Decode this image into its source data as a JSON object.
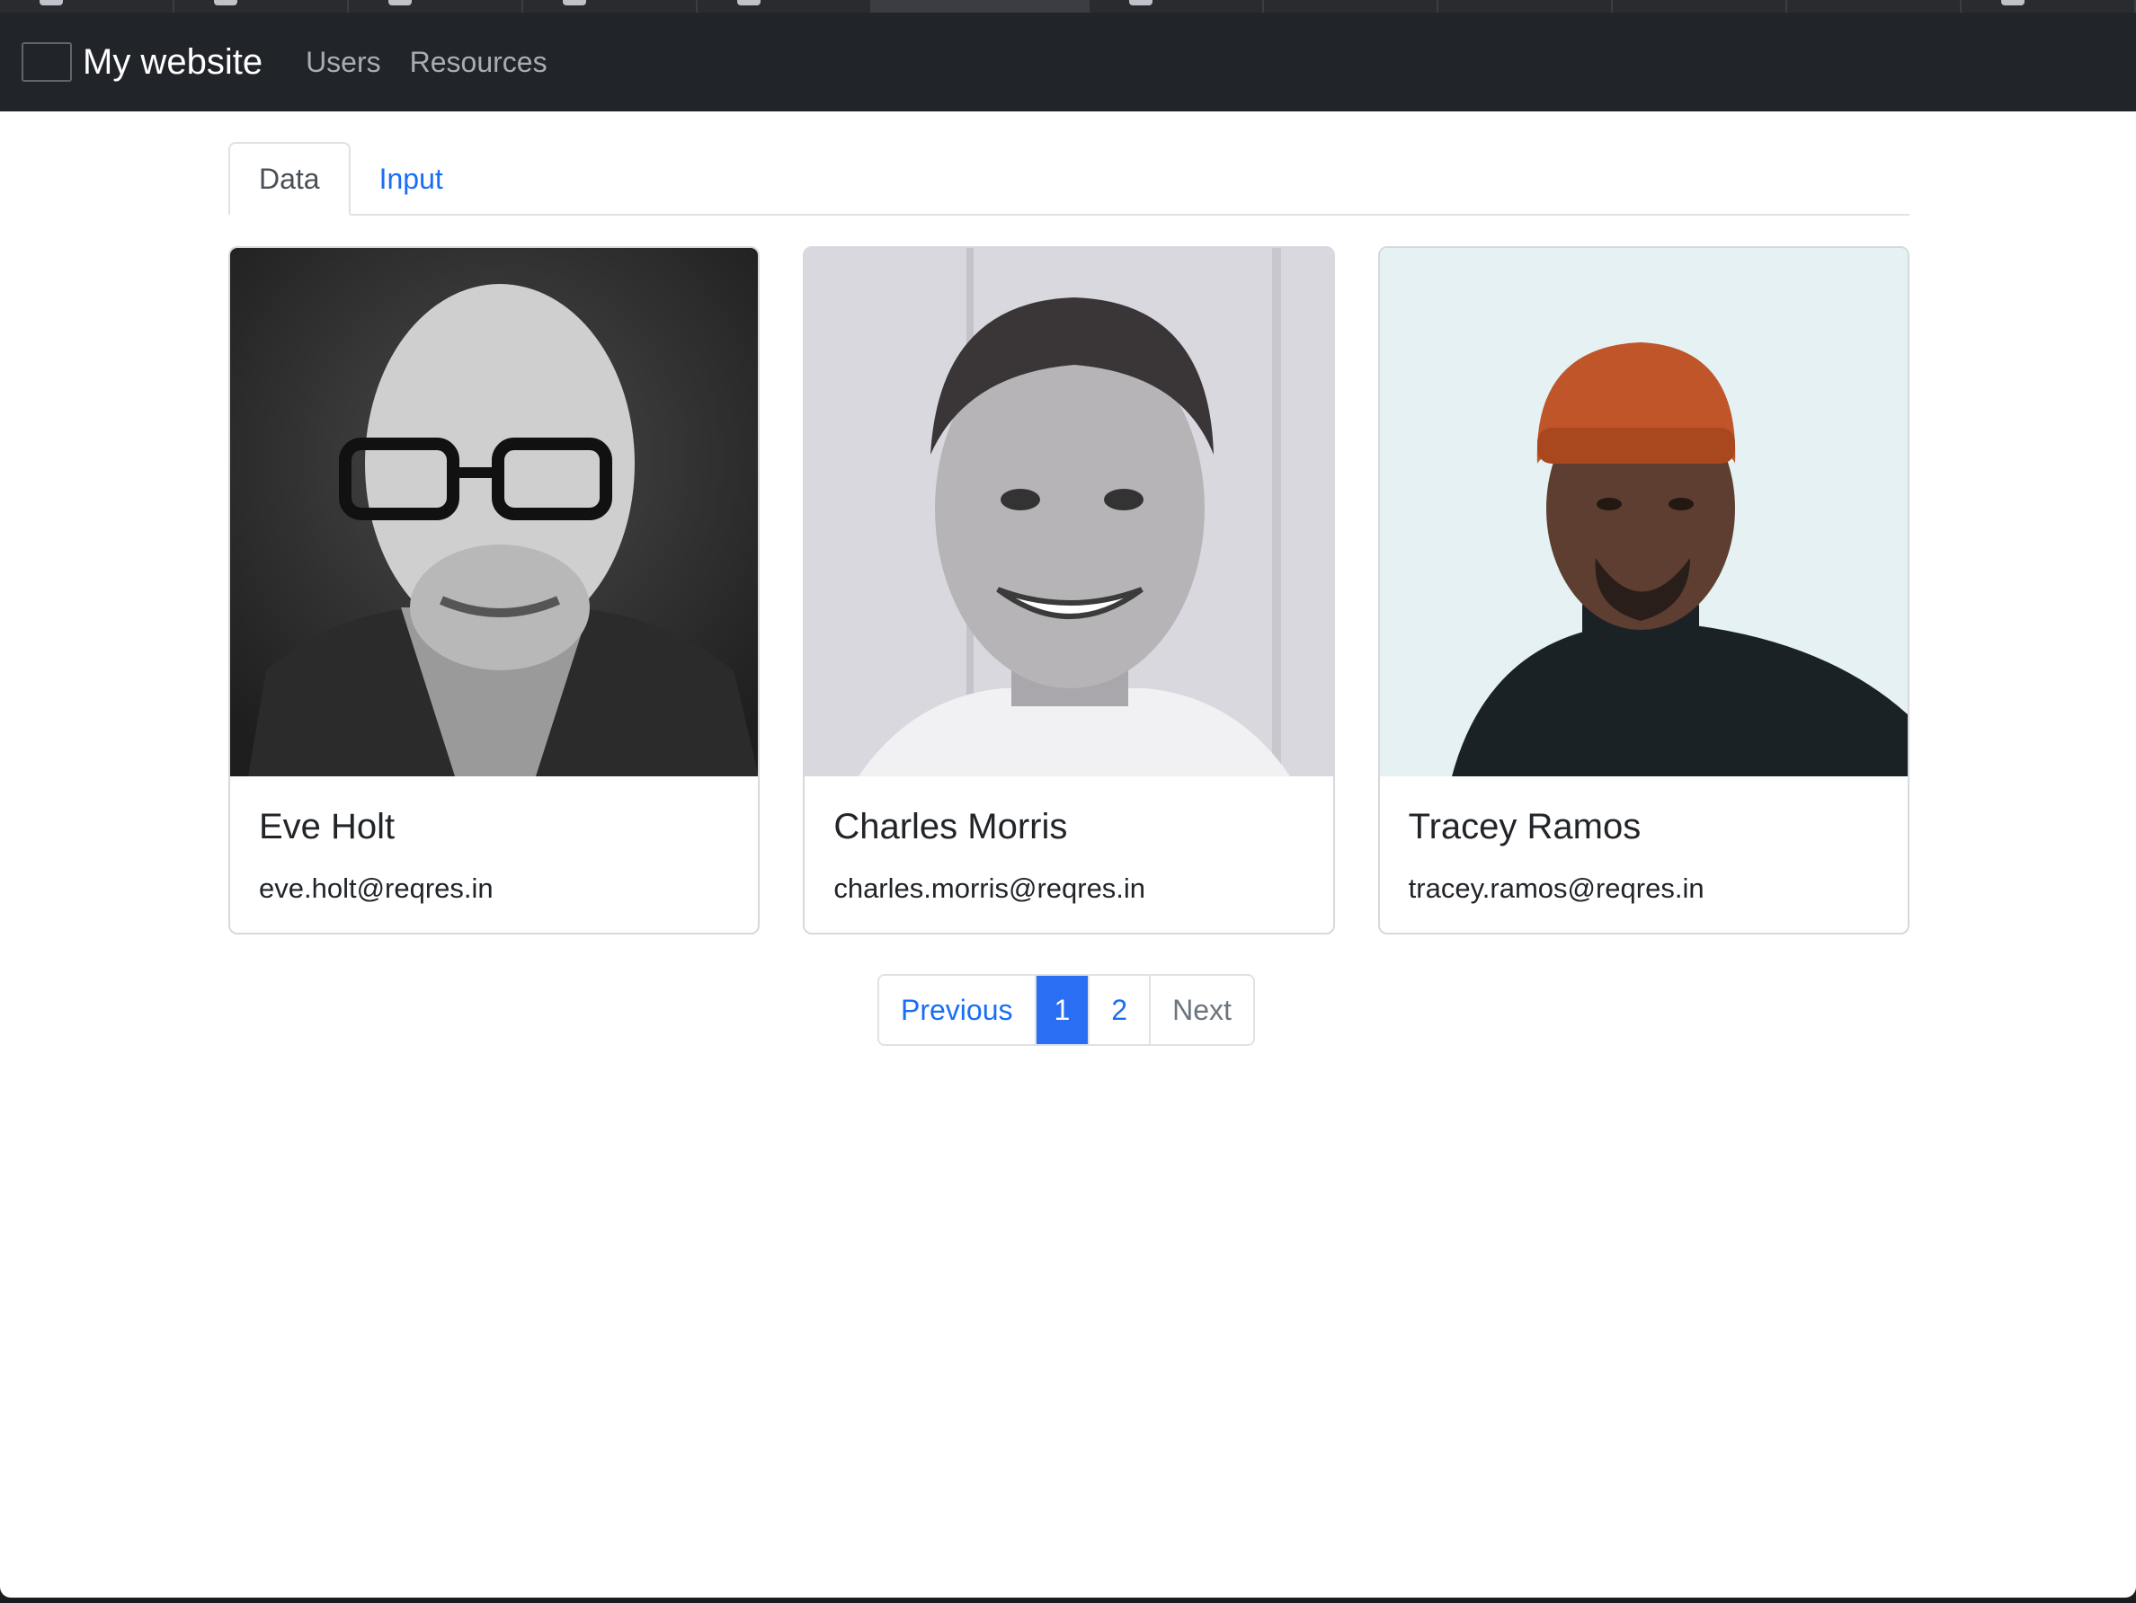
{
  "navbar": {
    "brand": "My website",
    "links": [
      "Users",
      "Resources"
    ]
  },
  "tabs": [
    {
      "label": "Data",
      "active": true
    },
    {
      "label": "Input",
      "active": false
    }
  ],
  "users": [
    {
      "name": "Eve Holt",
      "email": "eve.holt@reqres.in"
    },
    {
      "name": "Charles Morris",
      "email": "charles.morris@reqres.in"
    },
    {
      "name": "Tracey Ramos",
      "email": "tracey.ramos@reqres.in"
    }
  ],
  "pagination": {
    "previous": "Previous",
    "pages": [
      "1",
      "2"
    ],
    "current_page": "1",
    "next": "Next"
  },
  "colors": {
    "navbar_bg": "#212529",
    "accent": "#2a6ef3",
    "link": "#1a6ef5"
  }
}
